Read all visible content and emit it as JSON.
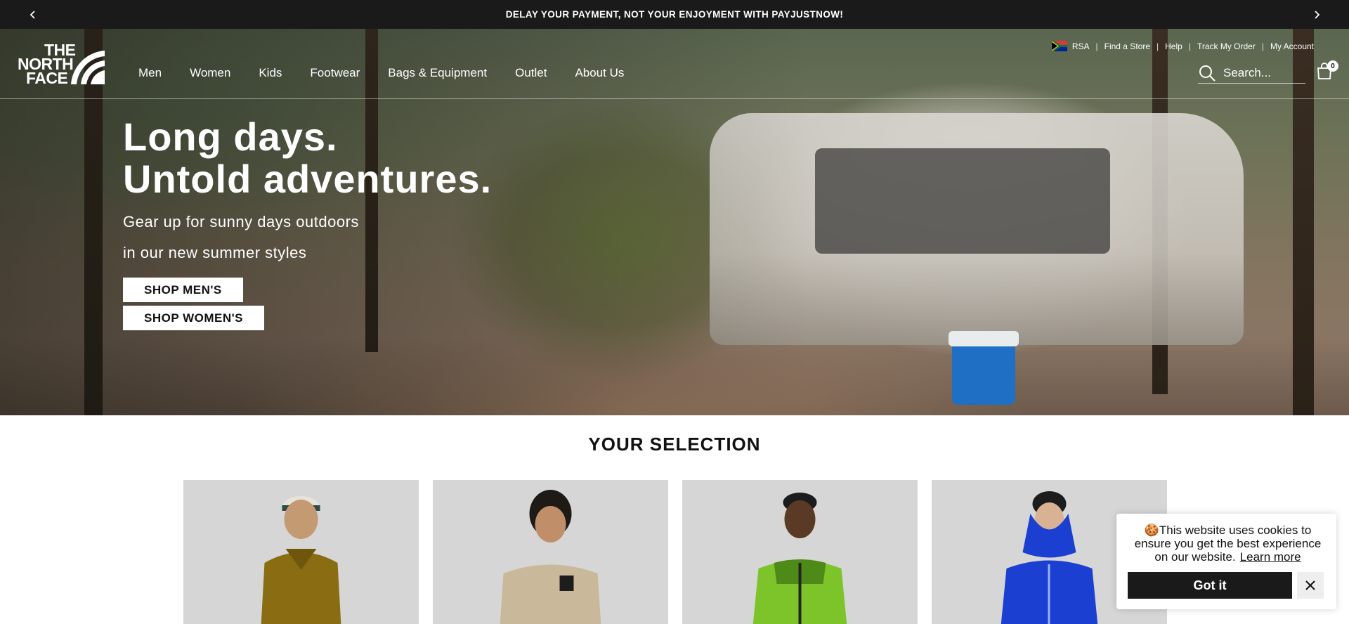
{
  "announcement": {
    "text": "DELAY YOUR PAYMENT, NOT YOUR ENJOYMENT WITH PAYJUSTNOW!",
    "prev_icon": "chevron-left-icon",
    "next_icon": "chevron-right-icon"
  },
  "header": {
    "logo": {
      "line1": "THE",
      "line2": "NORTH",
      "line3": "FACE"
    },
    "nav": [
      "Men",
      "Women",
      "Kids",
      "Footwear",
      "Bags & Equipment",
      "Outlet",
      "About Us"
    ],
    "utility": {
      "region": "RSA",
      "links": [
        "Find a Store",
        "Help",
        "Track My Order",
        "My Account"
      ]
    },
    "search": {
      "placeholder": "Search..."
    },
    "cart": {
      "count": "0"
    }
  },
  "hero": {
    "headline_line1": "Long days.",
    "headline_line2": "Untold adventures.",
    "subtext_line1": "Gear up for sunny days outdoors",
    "subtext_line2": "in our new summer styles",
    "buttons": [
      "SHOP MEN'S",
      "SHOP WOMEN'S"
    ]
  },
  "selection": {
    "title": "YOUR SELECTION",
    "products": [
      {
        "color": "#8a6d12",
        "icon": "puffer-jacket"
      },
      {
        "color": "#c9b99a",
        "icon": "t-shirt"
      },
      {
        "color": "#7cc42a",
        "icon": "softshell-jacket"
      },
      {
        "color": "#1b3fd1",
        "icon": "shell-jacket"
      }
    ]
  },
  "cookie": {
    "message": "This website uses cookies to ensure you get the best experience on our website.",
    "learn_more": "Learn more",
    "accept": "Got it",
    "icon": "cookie-icon",
    "close_icon": "close-icon"
  },
  "colors": {
    "announcement_bg": "#1a1a1a",
    "button_dark": "#1a1a1a",
    "cookie_close_bg": "#eeeeee"
  }
}
